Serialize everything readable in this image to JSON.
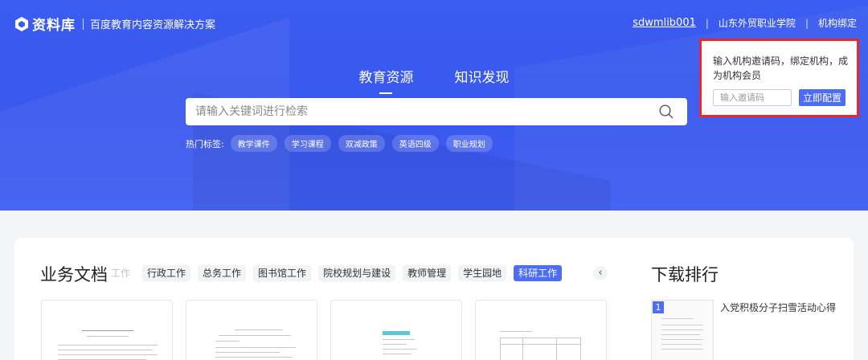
{
  "header": {
    "logo_text": "资料库",
    "slogan": "百度教育内容资源解决方案",
    "username": "sdwmlib001",
    "institution": "山东外贸职业学院",
    "bind_label": "机构绑定",
    "separator": "|"
  },
  "main_tabs": [
    {
      "label": "教育资源",
      "active": true
    },
    {
      "label": "知识发现",
      "active": false
    }
  ],
  "search": {
    "placeholder": "请输入关键词进行检索"
  },
  "hot_tags": {
    "label": "热门标签:",
    "tags": [
      "教学课件",
      "学习课程",
      "双减政策",
      "英语四级",
      "职业规划"
    ]
  },
  "invite_popup": {
    "text": "输入机构邀请码，绑定机构，成为机构会员",
    "input_placeholder": "输入邀请码",
    "button_label": "立即配置",
    "border_color": "#e8262b"
  },
  "docs_section": {
    "title": "业务文档",
    "categories": [
      {
        "label": "工作",
        "state": "faded"
      },
      {
        "label": "行政工作",
        "state": "normal"
      },
      {
        "label": "总务工作",
        "state": "normal"
      },
      {
        "label": "图书馆工作",
        "state": "normal"
      },
      {
        "label": "院校规划与建设",
        "state": "normal"
      },
      {
        "label": "教师管理",
        "state": "normal"
      },
      {
        "label": "学生园地",
        "state": "normal"
      },
      {
        "label": "科研工作",
        "state": "active"
      }
    ],
    "prev_icon": "‹"
  },
  "download_rank": {
    "title": "下载排行",
    "items": [
      {
        "rank": "1",
        "title": "入党积极分子扫雪活动心得"
      }
    ]
  },
  "colors": {
    "accent": "#4e6ef2",
    "hero_blue": "#3b5cf0"
  }
}
